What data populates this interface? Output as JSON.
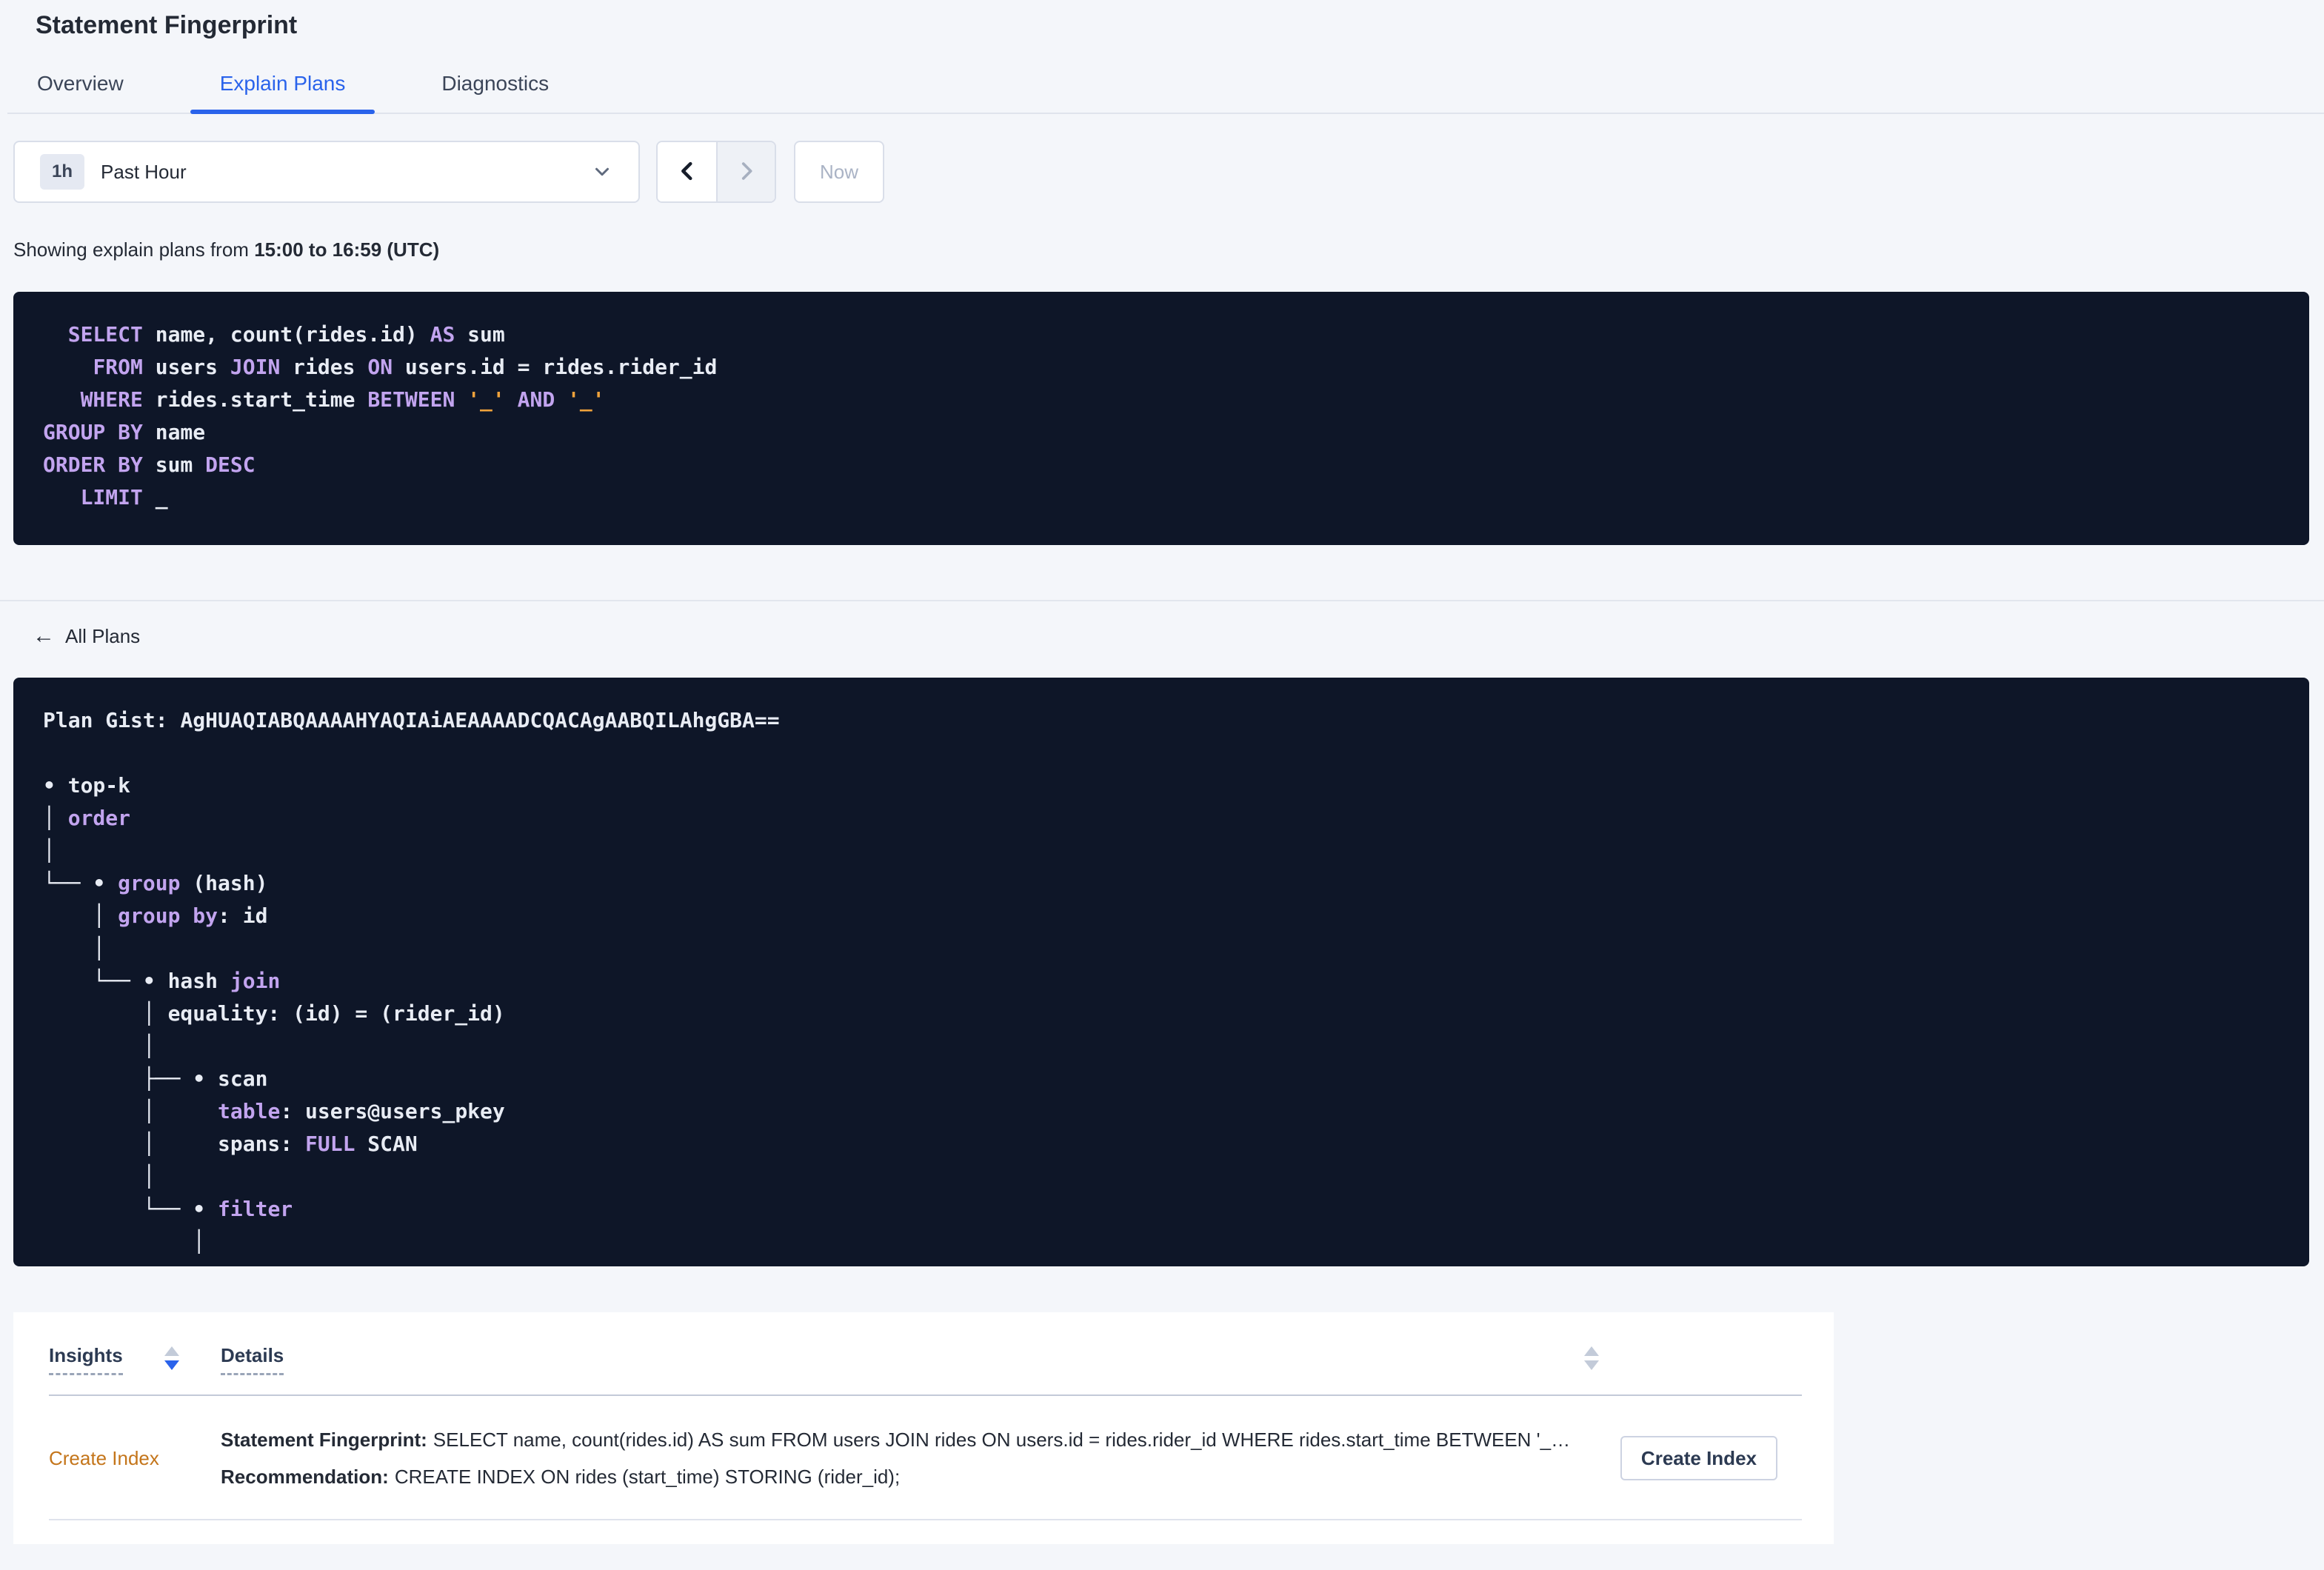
{
  "page": {
    "title": "Statement Fingerprint"
  },
  "tabs": [
    {
      "label": "Overview",
      "active": false
    },
    {
      "label": "Explain Plans",
      "active": true
    },
    {
      "label": "Diagnostics",
      "active": false
    }
  ],
  "time_picker": {
    "range_badge": "1h",
    "range_label": "Past Hour",
    "now_label": "Now"
  },
  "subtitle": {
    "prefix": "Showing explain plans from ",
    "range": "15:00 to 16:59 (UTC)"
  },
  "sql_lines": [
    [
      {
        "t": "  ",
        "c": "plain"
      },
      {
        "t": "SELECT",
        "c": "kw"
      },
      {
        "t": " name, count(rides.id) ",
        "c": "plain"
      },
      {
        "t": "AS",
        "c": "kw"
      },
      {
        "t": " sum",
        "c": "plain"
      }
    ],
    [
      {
        "t": "    ",
        "c": "plain"
      },
      {
        "t": "FROM",
        "c": "kw"
      },
      {
        "t": " users ",
        "c": "plain"
      },
      {
        "t": "JOIN",
        "c": "kw"
      },
      {
        "t": " rides ",
        "c": "plain"
      },
      {
        "t": "ON",
        "c": "kw"
      },
      {
        "t": " users.id = rides.rider_id",
        "c": "plain"
      }
    ],
    [
      {
        "t": "   ",
        "c": "plain"
      },
      {
        "t": "WHERE",
        "c": "kw"
      },
      {
        "t": " rides.start_time ",
        "c": "plain"
      },
      {
        "t": "BETWEEN",
        "c": "kw"
      },
      {
        "t": " ",
        "c": "plain"
      },
      {
        "t": "'_'",
        "c": "str"
      },
      {
        "t": " ",
        "c": "plain"
      },
      {
        "t": "AND",
        "c": "kw"
      },
      {
        "t": " ",
        "c": "plain"
      },
      {
        "t": "'_'",
        "c": "str"
      }
    ],
    [
      {
        "t": "GROUP BY",
        "c": "kw"
      },
      {
        "t": " name",
        "c": "plain"
      }
    ],
    [
      {
        "t": "ORDER BY",
        "c": "kw"
      },
      {
        "t": " sum ",
        "c": "plain"
      },
      {
        "t": "DESC",
        "c": "kw"
      }
    ],
    [
      {
        "t": "   ",
        "c": "plain"
      },
      {
        "t": "LIMIT",
        "c": "kw"
      },
      {
        "t": " _",
        "c": "plain"
      }
    ]
  ],
  "plan": {
    "back_label": "All Plans",
    "gist_label": "Plan Gist: ",
    "gist": "AgHUAQIABQAAAAHYAQIAiAEAAAADCQACAgAABQILAhgGBA==",
    "tree_lines": [
      [
        {
          "t": "• top-k",
          "c": "plain"
        }
      ],
      [
        {
          "t": "│ ",
          "c": "plain"
        },
        {
          "t": "order",
          "c": "kw"
        }
      ],
      [
        {
          "t": "│",
          "c": "plain"
        }
      ],
      [
        {
          "t": "└── • ",
          "c": "plain"
        },
        {
          "t": "group",
          "c": "kw"
        },
        {
          "t": " (hash)",
          "c": "plain"
        }
      ],
      [
        {
          "t": "    │ ",
          "c": "plain"
        },
        {
          "t": "group by",
          "c": "kw"
        },
        {
          "t": ": id",
          "c": "plain"
        }
      ],
      [
        {
          "t": "    │",
          "c": "plain"
        }
      ],
      [
        {
          "t": "    └── • hash ",
          "c": "plain"
        },
        {
          "t": "join",
          "c": "kw"
        }
      ],
      [
        {
          "t": "        │ equality: (id) = (rider_id)",
          "c": "plain"
        }
      ],
      [
        {
          "t": "        │",
          "c": "plain"
        }
      ],
      [
        {
          "t": "        ├── • scan",
          "c": "plain"
        }
      ],
      [
        {
          "t": "        │     ",
          "c": "plain"
        },
        {
          "t": "table",
          "c": "kw"
        },
        {
          "t": ": users@users_pkey",
          "c": "plain"
        }
      ],
      [
        {
          "t": "        │     spans: ",
          "c": "plain"
        },
        {
          "t": "FULL",
          "c": "kw"
        },
        {
          "t": " SCAN",
          "c": "plain"
        }
      ],
      [
        {
          "t": "        │",
          "c": "plain"
        }
      ],
      [
        {
          "t": "        └── • ",
          "c": "plain"
        },
        {
          "t": "filter",
          "c": "kw"
        }
      ],
      [
        {
          "t": "            │",
          "c": "plain"
        }
      ]
    ]
  },
  "insights_table": {
    "columns": [
      "Insights",
      "Details"
    ],
    "rows": [
      {
        "insight": "Create Index",
        "fingerprint_label": "Statement Fingerprint:",
        "fingerprint": "SELECT name, count(rides.id) AS sum FROM users JOIN rides ON users.id = rides.rider_id WHERE rides.start_time BETWEEN '_…",
        "recommendation_label": "Recommendation:",
        "recommendation": "CREATE INDEX ON rides (start_time) STORING (rider_id);",
        "action_label": "Create Index"
      }
    ]
  },
  "colors": {
    "page-bg": "#f4f6fa",
    "accent-blue": "#2a63eb",
    "code-bg": "#0e1628",
    "code-keyword": "#c2a4ef",
    "code-literal": "#efa23b",
    "code-text": "#e8ecf4",
    "insight-orange": "#c4751a"
  }
}
